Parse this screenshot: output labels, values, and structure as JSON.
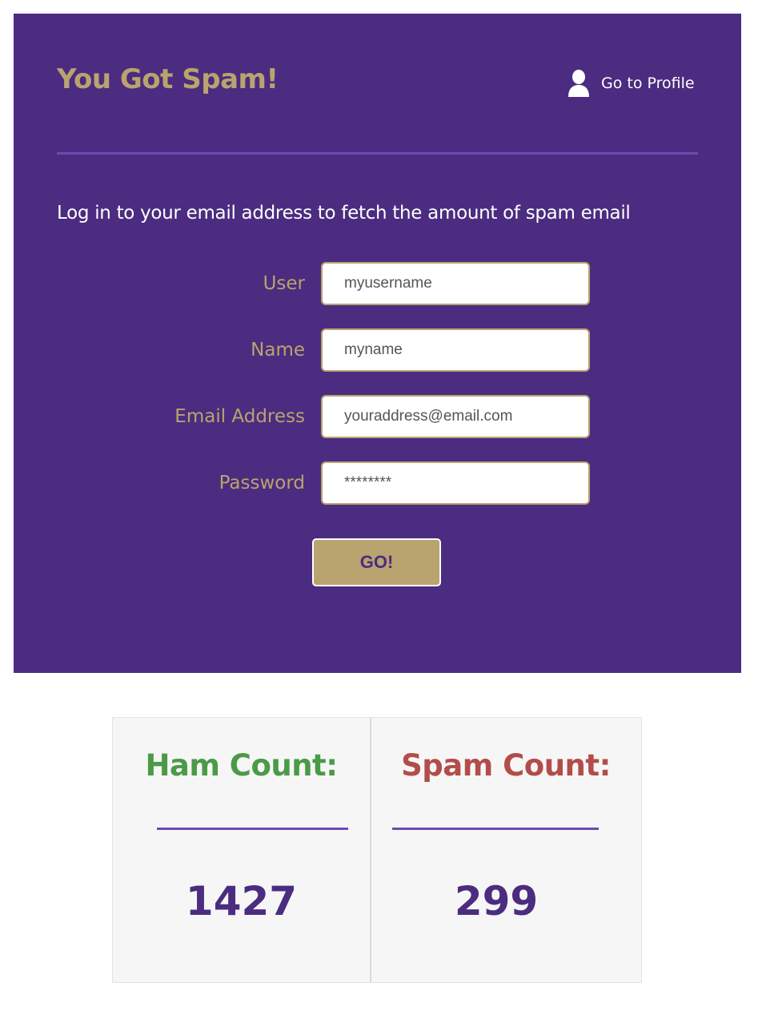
{
  "header": {
    "title": "You Got Spam!",
    "profile_link_label": "Go to Profile",
    "profile_icon": "user-icon"
  },
  "instruction": "Log in to your email address to fetch the amount of spam email",
  "form": {
    "fields": [
      {
        "label": "User",
        "value": "myusername"
      },
      {
        "label": "Name",
        "value": "myname"
      },
      {
        "label": "Email Address",
        "value": "youraddress@email.com"
      },
      {
        "label": "Password",
        "value": "********"
      }
    ],
    "submit_label": "GO!"
  },
  "stats": {
    "ham": {
      "label": "Ham Count:",
      "value": "1427"
    },
    "spam": {
      "label": "Spam Count:",
      "value": "299"
    }
  },
  "colors": {
    "panel_background": "#4b2c80",
    "accent_gold": "#b9a36f",
    "divider_purple": "#6a4bb2",
    "ham_green": "#4b9a47",
    "spam_red": "#b24d4a",
    "stats_background": "#f6f6f6"
  }
}
